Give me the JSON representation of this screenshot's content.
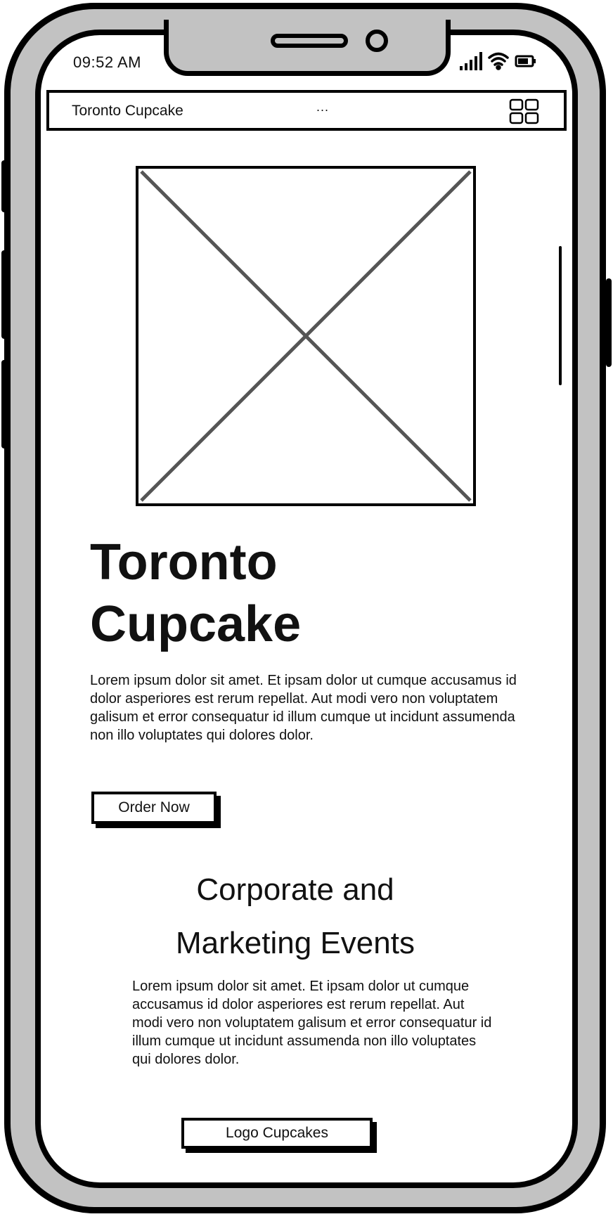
{
  "status_bar": {
    "time": "09:52 AM",
    "icons": [
      "signal-icon",
      "wifi-icon",
      "battery-icon"
    ]
  },
  "app_bar": {
    "title": "Toronto Cupcake",
    "more_label": "...",
    "menu_icon": "grid-icon"
  },
  "hero": {
    "image_icon": "image-placeholder-icon",
    "title": "Toronto Cupcake",
    "text": "Lorem ipsum dolor sit amet. Et ipsam dolor ut cumque accusamus id dolor asperiores est rerum repellat. Aut modi vero non voluptatem galisum et error consequatur id illum cumque ut incidunt assumenda non illo voluptates qui dolores dolor.",
    "cta_label": "Order Now"
  },
  "events": {
    "title": "Corporate and Marketing Events",
    "text": "Lorem ipsum dolor sit amet. Et ipsam dolor ut cumque accusamus id dolor asperiores est rerum repellat. Aut modi vero non voluptatem galisum et error consequatur id illum cumque ut incidunt assumenda non illo voluptates qui dolores dolor.",
    "button_label": "Logo Cupcakes"
  },
  "colors": {
    "frame": "#c2c2c2",
    "stroke": "#000000",
    "placeholder_x": "#555555",
    "screen": "#ffffff"
  }
}
